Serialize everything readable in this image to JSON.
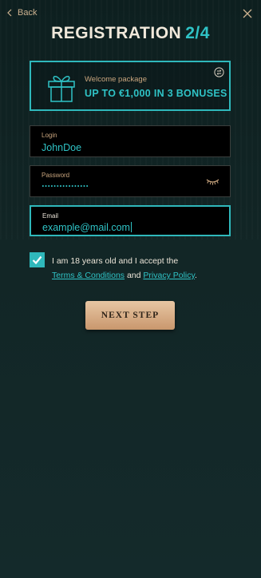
{
  "topbar": {
    "back_label": "Back"
  },
  "header": {
    "title": "REGISTRATION",
    "step": "2/4"
  },
  "welcome": {
    "label": "Welcome package",
    "bonus": "UP TO €1,000 IN 3 BONUSES"
  },
  "form": {
    "login": {
      "label": "Login",
      "value": "JohnDoe"
    },
    "password": {
      "label": "Password"
    },
    "email": {
      "label": "Email",
      "value": "example@mail.com"
    }
  },
  "consent": {
    "checked": true,
    "text_before": "I am 18 years old and I accept the",
    "terms_link": "Terms & Conditions",
    "and": " and ",
    "privacy_link": "Privacy Policy",
    "end": "."
  },
  "actions": {
    "next_label": "NEXT STEP"
  },
  "colors": {
    "accent": "#2fb8bb",
    "gold": "#c9a57e",
    "button": "#d9ad85"
  },
  "icons": [
    "chevron-left-icon",
    "close-icon",
    "gift-icon",
    "swap-icon",
    "eye-closed-icon",
    "checkmark-icon"
  ]
}
